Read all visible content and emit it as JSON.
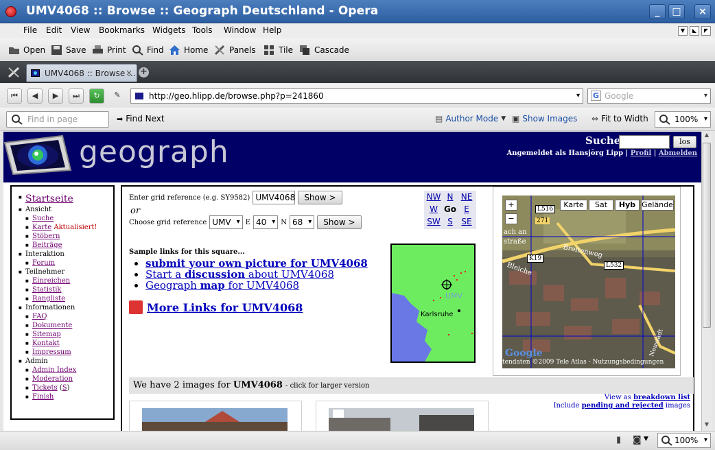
{
  "window": {
    "title": "UMV4068 :: Browse :: Geograph Deutschland - Opera"
  },
  "menu": [
    "File",
    "Edit",
    "View",
    "Bookmarks",
    "Widgets",
    "Tools",
    "Window",
    "Help"
  ],
  "toolbar": {
    "open": "Open",
    "save": "Save",
    "print": "Print",
    "find": "Find",
    "home": "Home",
    "panels": "Panels",
    "tile": "Tile",
    "cascade": "Cascade"
  },
  "tab": {
    "label": "UMV4068 :: Browse ..."
  },
  "address": {
    "url": "http://geo.hlipp.de/browse.php?p=241860",
    "search_placeholder": "Google"
  },
  "findbar": {
    "find_placeholder": "Find in page",
    "find_next": "Find Next",
    "author_mode": "Author Mode",
    "show_images": "Show Images",
    "fit_to_width": "Fit to Width",
    "zoom": "100%"
  },
  "site": {
    "logo": "geograph",
    "search_label": "Suche",
    "search_button": "los",
    "logged_in": "Angemeldet als Hansjörg Lipp",
    "profile": "Profil",
    "logout": "Abmelden"
  },
  "sidebar": {
    "home": "Startseite",
    "sections": [
      {
        "title": "Ansicht",
        "items": [
          "Suche",
          "Karte",
          "Stöbern",
          "Beiträge"
        ],
        "badge": "Aktualisiert!"
      },
      {
        "title": "Interaktion",
        "items": [
          "Forum"
        ]
      },
      {
        "title": "Teilnehmer",
        "items": [
          "Einreichen",
          "Statistik",
          "Rangliste"
        ]
      },
      {
        "title": "Informationen",
        "items": [
          "FAQ",
          "Dokumente",
          "Sitemap",
          "Kontakt",
          "Impressum"
        ]
      },
      {
        "title": "Admin",
        "items": [
          "Admin Index",
          "Moderation",
          "Tickets",
          "Finish"
        ]
      }
    ],
    "tickets_suffix": "S"
  },
  "form": {
    "grid_label": "Enter grid reference (e.g. SY9582)",
    "grid_value": "UMV4068",
    "show": "Show >",
    "or": "or",
    "choose_label": "Choose grid reference",
    "square": "UMV",
    "e_label": "E",
    "e_value": "40",
    "n_label": "N",
    "n_value": "68"
  },
  "compass": {
    "nw": "NW",
    "n": "N",
    "ne": "NE",
    "w": "W",
    "go": "Go",
    "e": "E",
    "sw": "SW",
    "s": "S",
    "se": "SE"
  },
  "sample": {
    "title": "Sample links for this square...",
    "link1_bold": "submit your own picture for UMV4068",
    "link2_pre": "Start a",
    "link2_bold": "discussion",
    "link2_post": "about UMV4068",
    "link3_pre": "Geograph",
    "link3_bold": "map",
    "link3_post": "for UMV4068",
    "more_links": "More Links for UMV4068"
  },
  "minimap": {
    "square_label": "UMV",
    "city": "Karlsruhe"
  },
  "gmap": {
    "buttons": [
      "Karte",
      "Sat",
      "Hyb",
      "Gelände"
    ],
    "road_labels": [
      "L516",
      "271",
      "K19",
      "L532",
      "Breitenweg",
      "straße",
      "Bleiche",
      "Neustadt",
      "ach an"
    ],
    "copyright": "tendaten ©2009 Tele Atlas - Nutzungsbedingungen",
    "google": "Google"
  },
  "images": {
    "count_text_pre": "We have 2 images for",
    "square": "UMV4068",
    "count_text_post": "- click for larger version",
    "view_as_pre": "View as",
    "view_as_link": "breakdown list",
    "include_pre": "Include",
    "include_link": "pending and rejected",
    "include_post": "images"
  },
  "status": {
    "zoom": "100%"
  }
}
